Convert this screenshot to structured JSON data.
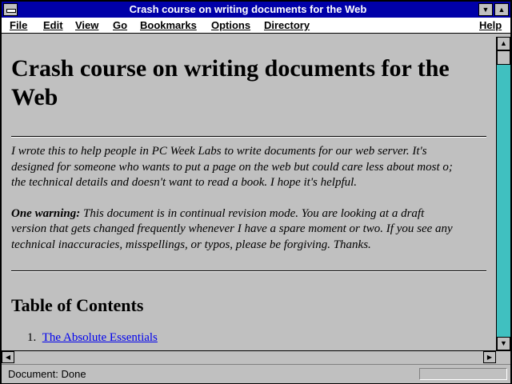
{
  "window": {
    "title": "Crash course on writing documents for the Web"
  },
  "menubar": {
    "items": [
      "File",
      "Edit",
      "View",
      "Go",
      "Bookmarks",
      "Options",
      "Directory",
      "Help"
    ]
  },
  "document": {
    "heading": "Crash course on writing documents for the Web",
    "intro_lines": [
      "I wrote this to help people in PC Week Labs to write documents for our web server. It's",
      "designed for someone who wants to put a page on the web but could care less about most o;",
      "the technical details and doesn't want to read a book. I hope it's helpful."
    ],
    "warning_label": "One warning:",
    "warning_lines": [
      "This document is in continual revision mode. You are looking at a draft",
      "version that gets changed frequently whenever I have a spare moment or two. If you see any",
      "technical inaccuracies, misspellings, or typos, please be forgiving. Thanks."
    ],
    "toc_heading": "Table of Contents",
    "toc_items": [
      {
        "number": "1.",
        "label": "The Absolute Essentials"
      }
    ]
  },
  "status": {
    "text": "Document: Done"
  },
  "colors": {
    "titlebar": "#0000a8",
    "link": "#0000ee",
    "scroll_track": "#40c0c0",
    "background": "#c0c0c0"
  }
}
